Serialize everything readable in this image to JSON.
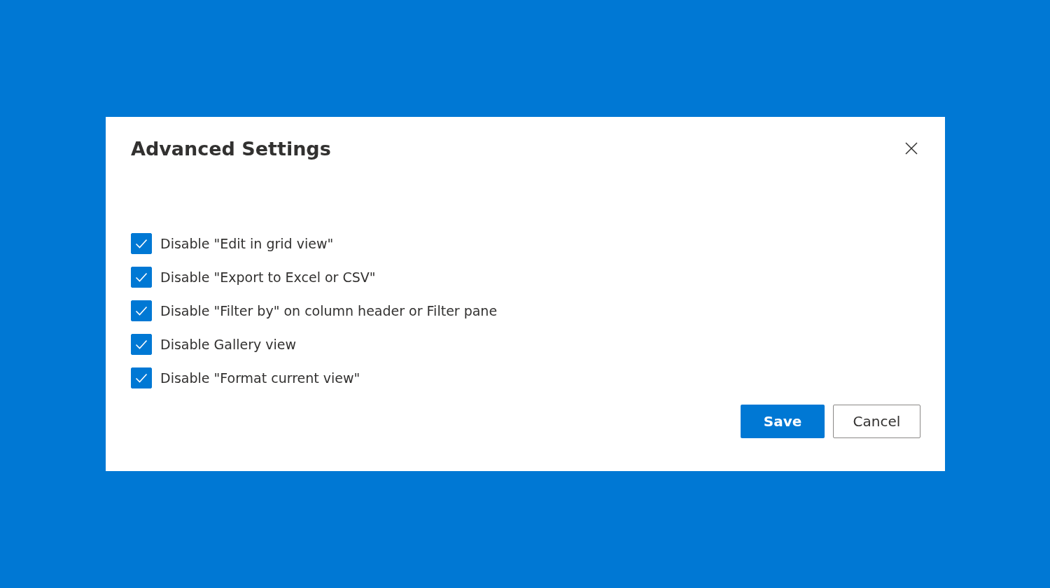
{
  "dialog": {
    "title": "Advanced Settings",
    "options": [
      {
        "label": "Disable \"Edit in grid view\"",
        "checked": true
      },
      {
        "label": "Disable \"Export to Excel or CSV\"",
        "checked": true
      },
      {
        "label": "Disable \"Filter by\" on column header or Filter pane",
        "checked": true
      },
      {
        "label": "Disable Gallery view",
        "checked": true
      },
      {
        "label": "Disable \"Format current view\"",
        "checked": true
      }
    ],
    "buttons": [
      {
        "label": "Save",
        "kind": "primary"
      },
      {
        "label": "Cancel",
        "kind": "secondary"
      }
    ]
  }
}
